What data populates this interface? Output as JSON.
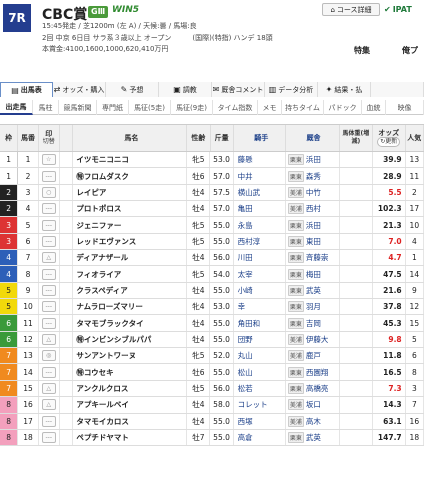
{
  "header": {
    "race_number": "7R",
    "race_name": "CBC賞",
    "grade": "GⅢ",
    "win5": "WIN5",
    "info": "15:45発走 / 芝1200m (左 A) / 天候:曇 / 馬場:良",
    "conditions": "2回 中京 6日目 サラ系３歳以上 オープン　　　(国際)(特指) ハンデ 18頭",
    "prize": "本賞金:4100,1600,1000,620,410万円",
    "course_label": "コース詳細",
    "ipat_label": "IPAT",
    "special_label": "特集",
    "haishin_label": "俺プ"
  },
  "tabs": [
    {
      "label": "出馬表",
      "icon": "▤"
    },
    {
      "label": "オッズ・購入",
      "icon": "⇄"
    },
    {
      "label": "予想",
      "icon": "✎"
    },
    {
      "label": "調教",
      "icon": "▣"
    },
    {
      "label": "厩舎コメント",
      "icon": "✉"
    },
    {
      "label": "データ分析",
      "icon": "▥"
    },
    {
      "label": "結果・払",
      "icon": "✦"
    },
    {
      "label": "",
      "icon": ""
    }
  ],
  "subtabs": [
    "出走馬",
    "馬柱",
    "競馬新聞",
    "専門紙",
    "馬征(5走)",
    "馬征(9走)",
    "タイム指数",
    "メモ",
    "持ちタイム",
    "パドック",
    "血統",
    "映像"
  ],
  "columns": {
    "waku": "枠",
    "ban": "馬番",
    "mark": "印",
    "mark_sub": "切替",
    "name": "馬名",
    "sex": "性齢",
    "weight": "斤量",
    "jockey": "騎手",
    "stable": "厩舎",
    "body": "馬体重(増減)",
    "odds": "オッズ",
    "odds_refresh": "更新",
    "pop": "人気"
  },
  "horses": [
    {
      "waku": "1",
      "ban": "1",
      "mark": "☆",
      "name": "イツモニコニコ",
      "sex": "牝5",
      "weight": "53.0",
      "jockey": "藤懸",
      "region": "栗東",
      "trainer": "浜田",
      "odds": "39.9",
      "pop": "13"
    },
    {
      "waku": "1",
      "ban": "2",
      "mark": "---",
      "name": "㊕フロムダスク",
      "sex": "牡6",
      "weight": "57.0",
      "jockey": "中井",
      "region": "栗東",
      "trainer": "森秀",
      "odds": "28.9",
      "pop": "11"
    },
    {
      "waku": "2",
      "ban": "3",
      "mark": "○",
      "name": "レイピア",
      "sex": "牡4",
      "weight": "57.5",
      "jockey": "横山武",
      "region": "美浦",
      "trainer": "中竹",
      "odds": "5.5",
      "pop": "2"
    },
    {
      "waku": "2",
      "ban": "4",
      "mark": "---",
      "name": "プロトポロス",
      "sex": "牡4",
      "weight": "57.0",
      "jockey": "亀田",
      "region": "美浦",
      "trainer": "西村",
      "odds": "102.3",
      "pop": "17"
    },
    {
      "waku": "3",
      "ban": "5",
      "mark": "---",
      "name": "ジェニファー",
      "sex": "牝5",
      "weight": "55.0",
      "jockey": "永島",
      "region": "栗東",
      "trainer": "浜田",
      "odds": "21.3",
      "pop": "10"
    },
    {
      "waku": "3",
      "ban": "6",
      "mark": "---",
      "name": "レッドエヴァンス",
      "sex": "牝5",
      "weight": "55.0",
      "jockey": "西村淳",
      "region": "栗東",
      "trainer": "東田",
      "odds": "7.0",
      "pop": "4"
    },
    {
      "waku": "4",
      "ban": "7",
      "mark": "△",
      "name": "ディアナザール",
      "sex": "牡4",
      "weight": "56.0",
      "jockey": "川田",
      "region": "栗東",
      "trainer": "斉藤崇",
      "odds": "4.7",
      "pop": "1"
    },
    {
      "waku": "4",
      "ban": "8",
      "mark": "---",
      "name": "フィオライア",
      "sex": "牝5",
      "weight": "54.0",
      "jockey": "太宰",
      "region": "栗東",
      "trainer": "梅田",
      "odds": "47.5",
      "pop": "14"
    },
    {
      "waku": "5",
      "ban": "9",
      "mark": "---",
      "name": "クラスペディア",
      "sex": "牡4",
      "weight": "55.0",
      "jockey": "小崎",
      "region": "栗東",
      "trainer": "武英",
      "odds": "21.6",
      "pop": "9"
    },
    {
      "waku": "5",
      "ban": "10",
      "mark": "---",
      "name": "ナムラローズマリー",
      "sex": "牝4",
      "weight": "53.0",
      "jockey": "幸",
      "region": "栗東",
      "trainer": "羽月",
      "odds": "37.8",
      "pop": "12"
    },
    {
      "waku": "6",
      "ban": "11",
      "mark": "---",
      "name": "タマモブラックタイ",
      "sex": "牡4",
      "weight": "55.0",
      "jockey": "角田和",
      "region": "栗東",
      "trainer": "吉岡",
      "odds": "45.3",
      "pop": "15"
    },
    {
      "waku": "6",
      "ban": "12",
      "mark": "△",
      "name": "㊕インビンシブルパパ",
      "sex": "牡4",
      "weight": "55.0",
      "jockey": "団野",
      "region": "美浦",
      "trainer": "伊藤大",
      "odds": "9.8",
      "pop": "5"
    },
    {
      "waku": "7",
      "ban": "13",
      "mark": "◎",
      "name": "サンアントワーヌ",
      "sex": "牝5",
      "weight": "52.0",
      "jockey": "丸山",
      "region": "美浦",
      "trainer": "鹿戸",
      "odds": "11.8",
      "pop": "6"
    },
    {
      "waku": "7",
      "ban": "14",
      "mark": "---",
      "name": "㊕コウセキ",
      "sex": "牡6",
      "weight": "55.0",
      "jockey": "松山",
      "region": "栗東",
      "trainer": "西園翔",
      "odds": "16.5",
      "pop": "8"
    },
    {
      "waku": "7",
      "ban": "15",
      "mark": "△",
      "name": "アンクルクロス",
      "sex": "牡5",
      "weight": "56.0",
      "jockey": "松若",
      "region": "栗東",
      "trainer": "高橋亮",
      "odds": "7.3",
      "pop": "3"
    },
    {
      "waku": "8",
      "ban": "16",
      "mark": "△",
      "name": "アプキールベイ",
      "sex": "牡4",
      "weight": "58.0",
      "jockey": "コレット",
      "region": "美浦",
      "trainer": "坂口",
      "odds": "14.3",
      "pop": "7"
    },
    {
      "waku": "8",
      "ban": "17",
      "mark": "---",
      "name": "タマモイカロス",
      "sex": "牡4",
      "weight": "55.0",
      "jockey": "西塚",
      "region": "美浦",
      "trainer": "高木",
      "odds": "63.1",
      "pop": "16"
    },
    {
      "waku": "8",
      "ban": "18",
      "mark": "---",
      "name": "ペプチドヤマト",
      "sex": "牡7",
      "weight": "55.0",
      "jockey": "高倉",
      "region": "栗東",
      "trainer": "武英",
      "odds": "147.7",
      "pop": "18"
    }
  ]
}
